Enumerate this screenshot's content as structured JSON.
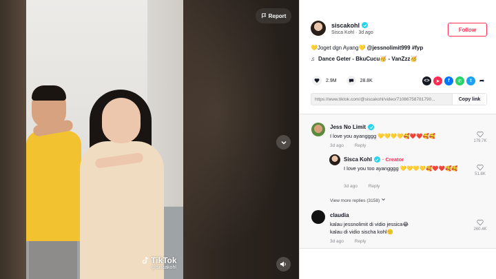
{
  "video": {
    "report_label": "Report",
    "watermark_brand": "TikTok",
    "watermark_user": "@siscakohl"
  },
  "author": {
    "username": "siscakohl",
    "display_name": "Sisca Kohl",
    "time_ago": "3d ago",
    "follow_label": "Follow"
  },
  "caption": {
    "text": "Joget dgn Ayang",
    "mention": "@jessnolimit999",
    "hashtag": "#fyp"
  },
  "music": {
    "title": "Dance Geter - BkuCucu🥳 - VanZzz🥳"
  },
  "stats": {
    "likes": "2.9M",
    "comments": "28.8K"
  },
  "share": {
    "icons": [
      "embed-icon",
      "send-icon",
      "facebook-icon",
      "whatsapp-icon",
      "twitter-icon",
      "share-arrow-icon"
    ],
    "colors": [
      "#161823",
      "#fe2c55",
      "#0075fa",
      "#25d366",
      "#1da1f2",
      "#161823"
    ]
  },
  "copy_link": {
    "url": "https://www.tiktok.com/@siscakohl/video/71086758781790...",
    "button_label": "Copy link"
  },
  "comments": [
    {
      "name": "Jess No Limit",
      "text": "I love you ayangggg 💛💛💛💛🥰❤️❤️🥰🥰",
      "time": "3d ago",
      "reply_label": "Reply",
      "likes": "179.7K"
    },
    {
      "name": "Sisca Kohl",
      "badge": "Creator",
      "text": "I love you too ayangggg 💛💛💛💛🥰❤️❤️🥰🥰",
      "time": "3d ago",
      "reply_label": "Reply",
      "likes": "51.8K"
    },
    {
      "name": "claudia",
      "text": "kalau jessnolimit di vidio jessica😂",
      "text2": "kalau di vidio sischa kohl🙂",
      "time": "3d ago",
      "reply_label": "Reply",
      "likes": "260.4K"
    }
  ],
  "view_more_replies": "View more replies (3158)",
  "colors": {
    "accent": "#fe2c55",
    "verified": "#20d5ec"
  }
}
